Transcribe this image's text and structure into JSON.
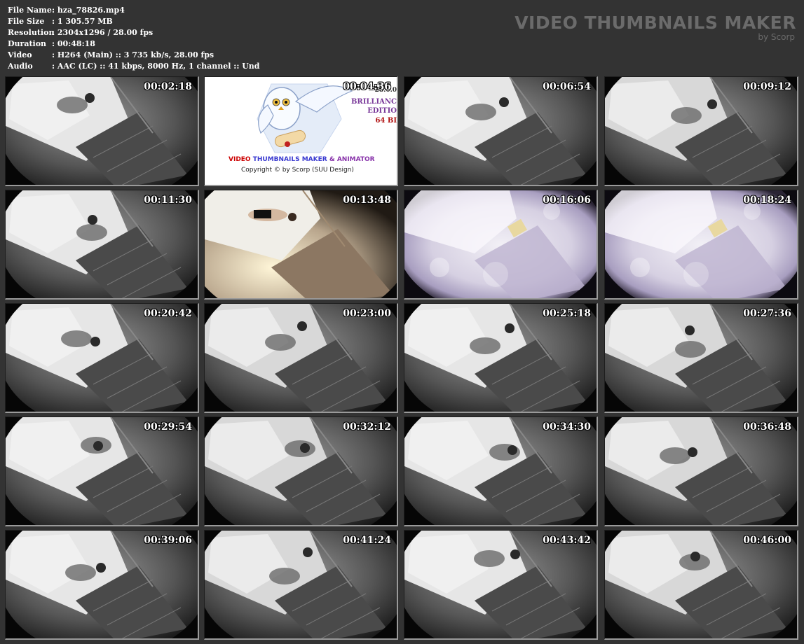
{
  "header": {
    "info": [
      {
        "label": "File Name",
        "value": ": hza_78826.mp4"
      },
      {
        "label": "File Size",
        "value": ": 1 305.57 MB"
      },
      {
        "label": "Resolution",
        "value": ": 2304x1296 / 28.00 fps"
      },
      {
        "label": "Duration",
        "value": ": 00:48:18"
      },
      {
        "label": "Video",
        "value": ": H264 (Main) :: 3 735 kb/s, 28.00 fps"
      },
      {
        "label": "Audio",
        "value": ": AAC (LC) :: 41 kbps, 8000 Hz, 1 channel :: Und"
      }
    ],
    "brand_title": "VIDEO THUMBNAILS MAKER",
    "brand_sub": "by Scorp"
  },
  "logo_card": {
    "line1_part1": "VIDEO THUMBNAILS MAKER",
    "line1_part2": " & ANIMATOR",
    "line2": "Copyright © by Scorp (SUU Design)",
    "edition_version": "28.0.0",
    "edition_name": "BRILLIANC",
    "edition_word": "EDITIO",
    "edition_bits": "64 BI",
    "colors": {
      "video": "#cc0000",
      "thumbnails": "#3a3ad0",
      "animator": "#8833aa"
    }
  },
  "thumbnails": [
    {
      "time": "00:02:18",
      "scene": "bw"
    },
    {
      "time": "00:04:36",
      "scene": "logo"
    },
    {
      "time": "00:06:54",
      "scene": "bw"
    },
    {
      "time": "00:09:12",
      "scene": "bw"
    },
    {
      "time": "00:11:30",
      "scene": "bw"
    },
    {
      "time": "00:13:48",
      "scene": "color"
    },
    {
      "time": "00:16:06",
      "scene": "bright"
    },
    {
      "time": "00:18:24",
      "scene": "bright"
    },
    {
      "time": "00:20:42",
      "scene": "bw"
    },
    {
      "time": "00:23:00",
      "scene": "bw"
    },
    {
      "time": "00:25:18",
      "scene": "bw"
    },
    {
      "time": "00:27:36",
      "scene": "bw"
    },
    {
      "time": "00:29:54",
      "scene": "bw"
    },
    {
      "time": "00:32:12",
      "scene": "bw"
    },
    {
      "time": "00:34:30",
      "scene": "bw"
    },
    {
      "time": "00:36:48",
      "scene": "bw"
    },
    {
      "time": "00:39:06",
      "scene": "bw"
    },
    {
      "time": "00:41:24",
      "scene": "bw"
    },
    {
      "time": "00:43:42",
      "scene": "bw"
    },
    {
      "time": "00:46:00",
      "scene": "bw"
    }
  ]
}
